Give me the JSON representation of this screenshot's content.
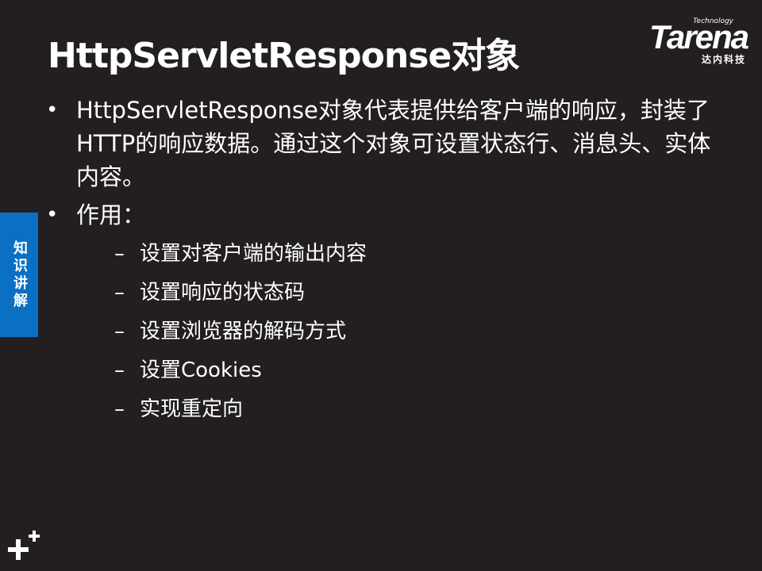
{
  "slide": {
    "title": "HttpServletResponse对象",
    "logo": {
      "tagline": "Technology",
      "wordmark": "Tarena",
      "chinese": "达内科技"
    },
    "side_tab": "知识讲解",
    "bullets": [
      {
        "text": "HttpServletResponse对象代表提供给客户端的响应，封装了HTTP的响应数据。通过这个对象可设置状态行、消息头、实体内容。"
      },
      {
        "text": "作用：",
        "items": [
          "设置对客户端的输出内容",
          "设置响应的状态码",
          "设置浏览器的解码方式",
          "设置Cookies",
          "实现重定向"
        ]
      }
    ],
    "bullet_symbol": "•",
    "dash_symbol": "–"
  },
  "colors": {
    "background": "#231f20",
    "text": "#ffffff",
    "accent_tab": "#0b6fc4"
  }
}
